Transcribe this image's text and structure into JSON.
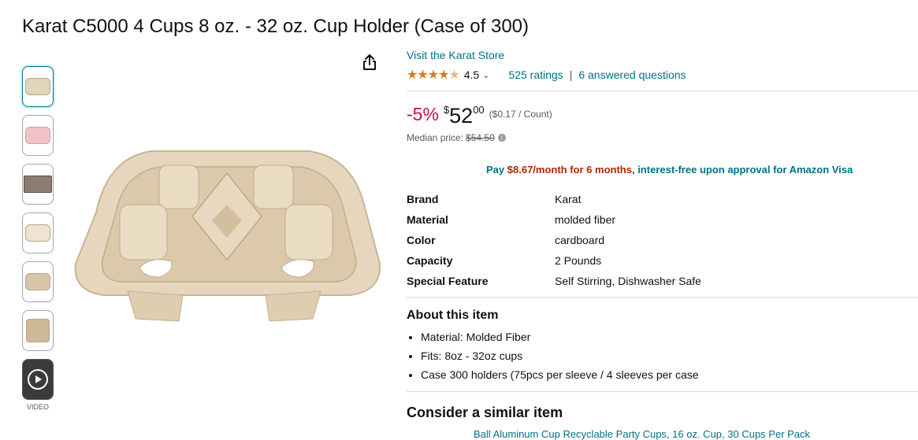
{
  "product": {
    "title": "Karat C5000 4 Cups 8 oz. - 32 oz. Cup Holder (Case of 300)",
    "store_link": "Visit the Karat Store",
    "rating_value": "4.5",
    "ratings_count": "525 ratings",
    "answered_questions": "6 answered questions",
    "discount": "-5%",
    "price_symbol": "$",
    "price_whole": "52",
    "price_fraction": "00",
    "price_per_unit": "($0.17 / Count)",
    "median_label": "Median price:",
    "median_price": "$54.50",
    "promo_pay": "Pay",
    "promo_amount": "$8.67/month for 6 months",
    "promo_rest": ", interest-free upon approval for Amazon Visa"
  },
  "specs": [
    {
      "key": "Brand",
      "value": "Karat"
    },
    {
      "key": "Material",
      "value": "molded fiber"
    },
    {
      "key": "Color",
      "value": "cardboard"
    },
    {
      "key": "Capacity",
      "value": "2 Pounds"
    },
    {
      "key": "Special Feature",
      "value": "Self Stirring, Dishwasher Safe"
    }
  ],
  "about": {
    "title": "About this item",
    "bullets": [
      "Material: Molded Fiber",
      "Fits: 8oz - 32oz cups",
      "Case 300 holders (75pcs per sleeve / 4 sleeves per case"
    ]
  },
  "similar": {
    "title": "Consider a similar item",
    "link": "Ball Aluminum Cup Recyclable Party Cups, 16 oz. Cup, 30 Cups Per Pack"
  },
  "thumbnails": {
    "video_label": "VIDEO"
  },
  "colors": {
    "link": "#007185",
    "discount": "#cc0c39",
    "star": "#de7921",
    "promo_price": "#b12704"
  }
}
